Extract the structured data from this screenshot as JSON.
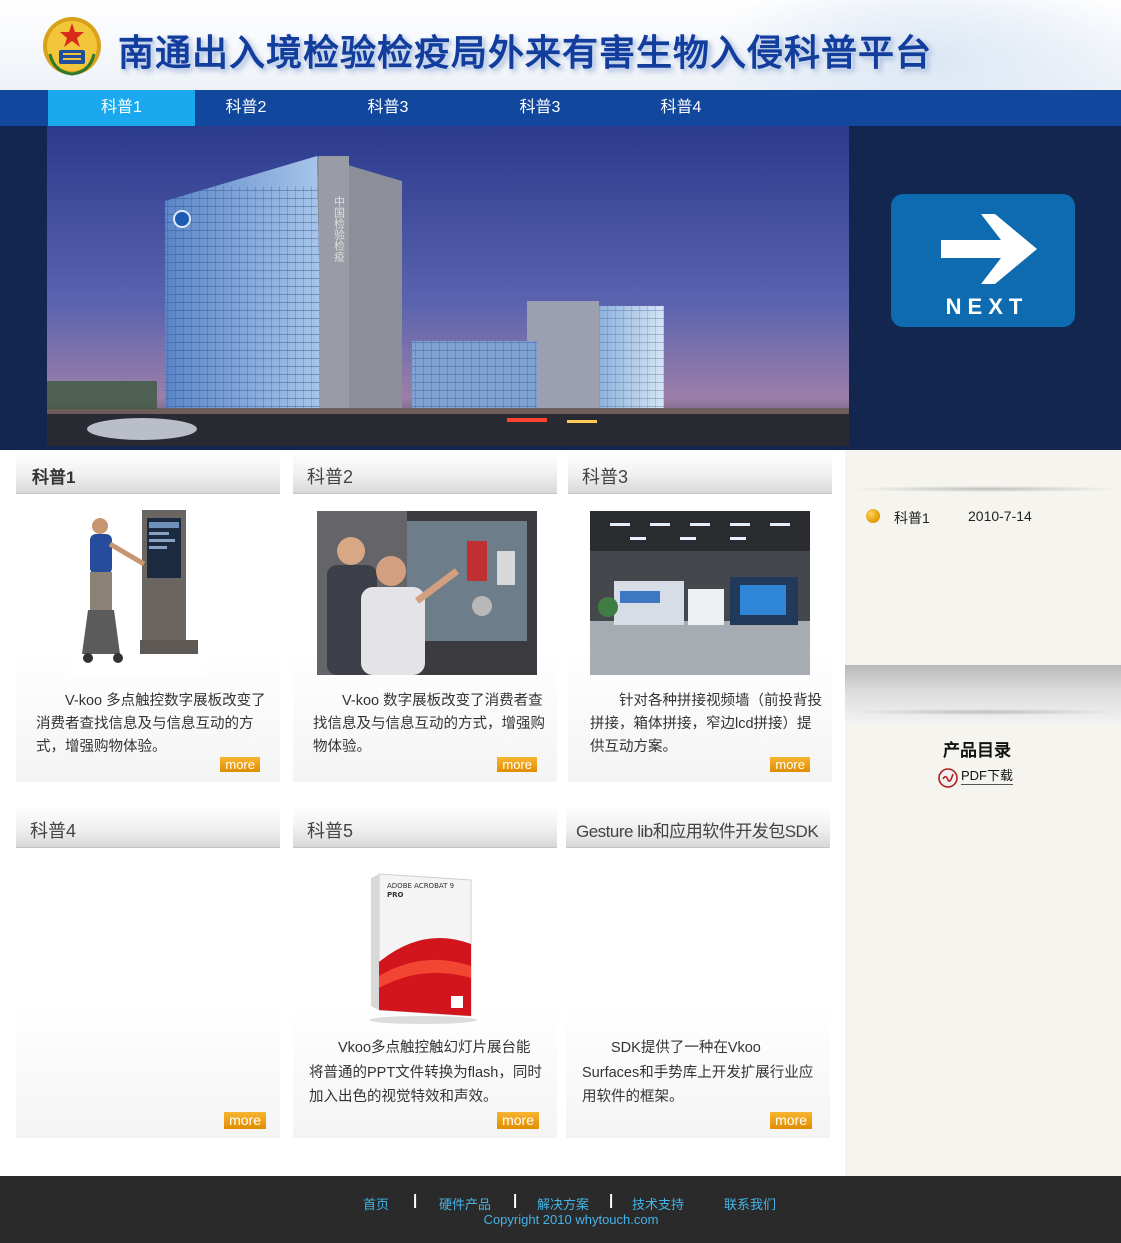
{
  "header": {
    "title": "南通出入境检验检疫局外来有害生物入侵科普平台"
  },
  "nav": {
    "items": [
      "科普1",
      "科普2",
      "科普3",
      "科普3",
      "科普4"
    ],
    "active_index": 0
  },
  "banner": {
    "next_label": "NEXT",
    "building_sign": "中国检验检疫"
  },
  "cards": [
    {
      "title": "科普1",
      "text": "V-koo 多点触控数字展板改变了消费者查找信息及与信息互动的方式，增强购物体验。",
      "more": "more",
      "image": "kiosk-photo"
    },
    {
      "title": "科普2",
      "text": "V-koo 数字展板改变了消费者查找信息及与信息互动的方式，增强购物体验。",
      "more": "more",
      "image": "touch-wall-photo"
    },
    {
      "title": "科普3",
      "text": "针对各种拼接视频墙（前投背投拼接，箱体拼接，窄边lcd拼接）提供互动方案。",
      "more": "more",
      "image": "showroom-photo"
    },
    {
      "title": "科普4",
      "text": "",
      "more": "more",
      "image": ""
    },
    {
      "title": "科普5",
      "text": "Vkoo多点触控触幻灯片展台能将普通的PPT文件转换为flash，同时加入出色的视觉特效和声效。",
      "more": "more",
      "image": "software-box"
    },
    {
      "title": "Gesture lib和应用软件开发包SDK",
      "text": "SDK提供了一种在Vkoo Surfaces和手势库上开发扩展行业应用软件的框架。",
      "more": "more",
      "image": ""
    }
  ],
  "software_box": {
    "brand": "ADOBE ACROBAT 9",
    "edition": "PRO"
  },
  "sidebar": {
    "news": [
      {
        "title": "科普1",
        "date": "2010-7-14"
      }
    ],
    "catalog_title": "产品目录",
    "pdf_label": "PDF下载"
  },
  "footer": {
    "links": [
      "首页",
      "硬件产品",
      "解决方案",
      "技术支持",
      "联系我们"
    ],
    "separator": "|",
    "copyright": "Copyright 2010 whytouch.com"
  },
  "colors": {
    "nav_bg": "#11479d",
    "nav_active": "#1aa9ee",
    "banner_bg": "#13264f",
    "next_button": "#0e6bb0",
    "more_button": "#f0a11a",
    "footer_bg": "#2a2a2a",
    "footer_link": "#44b3e6",
    "title_blue": "#123d9c"
  }
}
